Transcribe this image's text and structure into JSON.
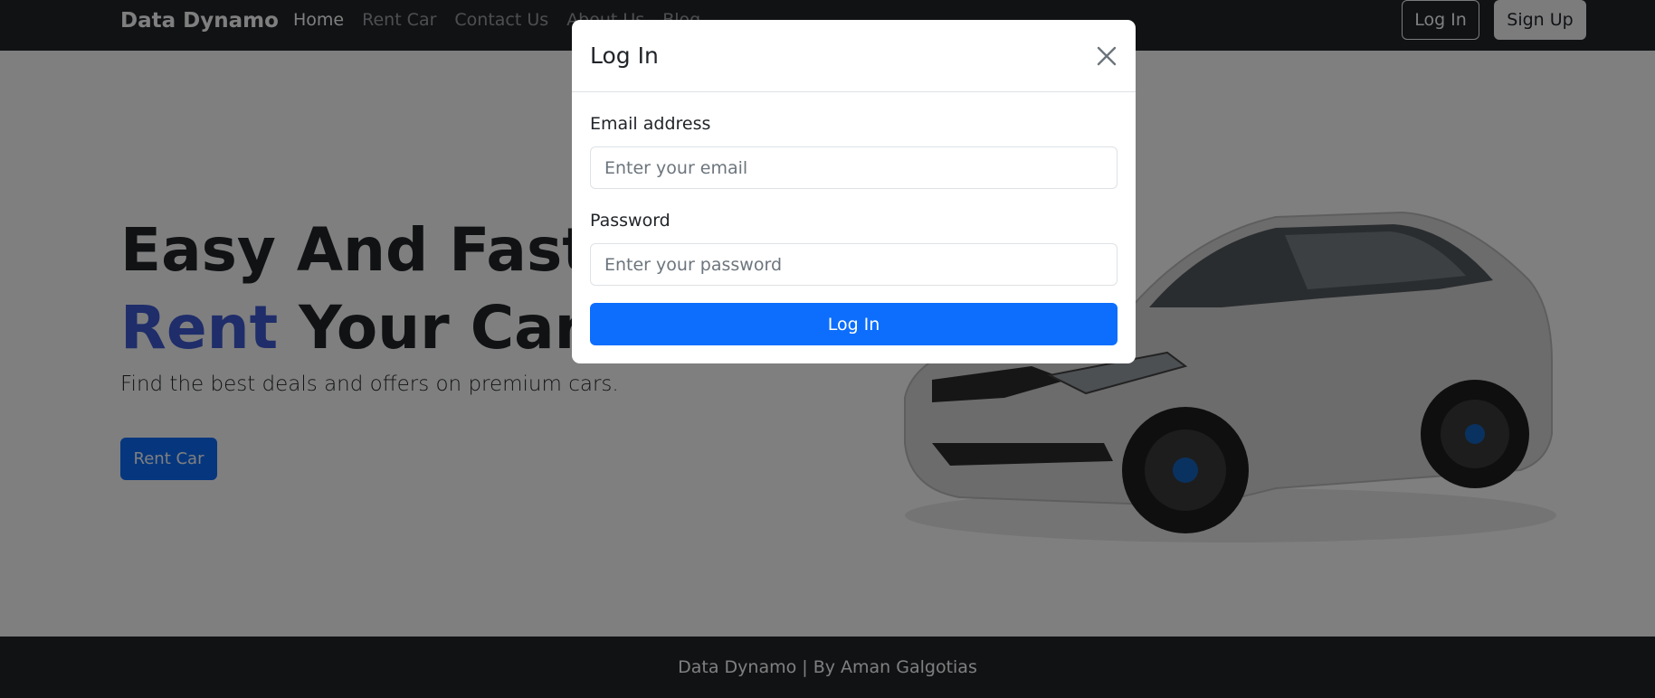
{
  "navbar": {
    "brand": "Data Dynamo",
    "links": [
      {
        "label": "Home",
        "active": true
      },
      {
        "label": "Rent Car"
      },
      {
        "label": "Contact Us"
      },
      {
        "label": "About Us"
      },
      {
        "label": "Blog"
      }
    ],
    "login_label": "Log In",
    "signup_label": "Sign Up"
  },
  "hero": {
    "title_line1": "Easy And Fast Way To",
    "title_accent": "Rent",
    "title_rest": "Your Car",
    "subtitle": "Find the best deals and offers on premium cars.",
    "cta_label": "Rent Car"
  },
  "footer": {
    "text": "Data Dynamo | By Aman Galgotias"
  },
  "modal": {
    "title": "Log In",
    "email_label": "Email address",
    "email_placeholder": "Enter your email",
    "password_label": "Password",
    "password_placeholder": "Enter your password",
    "submit_label": "Log In"
  },
  "colors": {
    "navbar_bg": "#212529",
    "primary": "#0d6efd",
    "accent_text": "#3f5bd4",
    "backdrop": "rgba(0,0,0,0.5)"
  }
}
